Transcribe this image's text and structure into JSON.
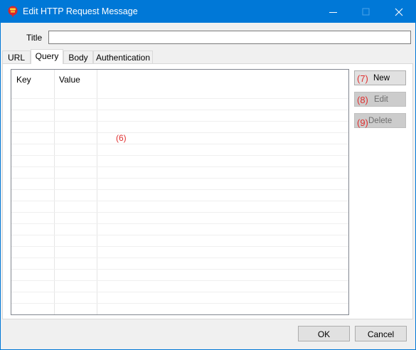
{
  "window": {
    "title": "Edit HTTP Request Message",
    "icon": "app-pin-icon",
    "controls": [
      "minimize-icon",
      "maximize-icon",
      "close-icon"
    ]
  },
  "form": {
    "title_label": "Title",
    "title_value": ""
  },
  "tabs": [
    {
      "label": "URL",
      "active": false
    },
    {
      "label": "Query",
      "active": true
    },
    {
      "label": "Body",
      "active": false
    },
    {
      "label": "Authentication",
      "active": false
    }
  ],
  "grid": {
    "columns": [
      "Key",
      "Value"
    ],
    "marker": "(6)",
    "rows": []
  },
  "side_buttons": {
    "new": {
      "marker": "(7)",
      "label": "New",
      "enabled": true
    },
    "edit": {
      "marker": "(8)",
      "label": "Edit",
      "enabled": false
    },
    "delete": {
      "marker": "(9)",
      "label": "Delete",
      "enabled": false
    }
  },
  "footer": {
    "ok_label": "OK",
    "cancel_label": "Cancel"
  },
  "colors": {
    "titlebar": "#0078d7",
    "marker_red": "#e03030",
    "disabled_text": "#6d6d6d"
  }
}
